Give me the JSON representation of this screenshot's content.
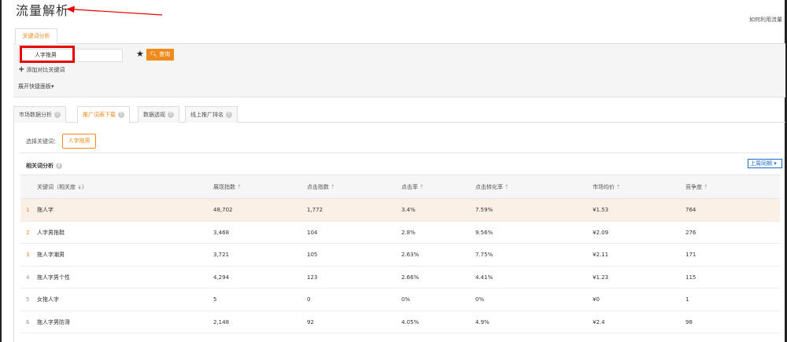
{
  "header": {
    "title": "流量解析",
    "help_link": "如何利用流量"
  },
  "keyword_tab": {
    "label": "关键词分析"
  },
  "search": {
    "value": "人字拖男",
    "query_label": "查询",
    "add_compare": "添加对比关键词",
    "expand_panel": "展开快捷面板▾"
  },
  "nav_tabs": [
    {
      "label": "市场数据分析"
    },
    {
      "label": "推广词表下载"
    },
    {
      "label": "数据透视"
    },
    {
      "label": "线上推广排名"
    }
  ],
  "select_keyword": {
    "label": "选择关键词：",
    "chip": "人字拖男"
  },
  "related": {
    "title": "相关词分析",
    "period": "上周同期 ▾"
  },
  "table": {
    "headers": [
      "关键词（相关度 ⇣）",
      "展现指数",
      "点击指数",
      "点击率",
      "点击转化率",
      "市场均价",
      "竞争度"
    ],
    "rows": [
      {
        "rank": "1",
        "keyword": "拖人字",
        "impressions": "48,702",
        "clicks": "1,772",
        "ctr": "3.4%",
        "cvr": "7.59%",
        "price": "¥1.53",
        "competition": "764"
      },
      {
        "rank": "2",
        "keyword": "人字男拖鞋",
        "impressions": "3,468",
        "clicks": "104",
        "ctr": "2.8%",
        "cvr": "9.56%",
        "price": "¥2.09",
        "competition": "276"
      },
      {
        "rank": "3",
        "keyword": "拖人字潮男",
        "impressions": "3,721",
        "clicks": "105",
        "ctr": "2.63%",
        "cvr": "7.75%",
        "price": "¥2.11",
        "competition": "171"
      },
      {
        "rank": "4",
        "keyword": "拖人字男个性",
        "impressions": "4,294",
        "clicks": "123",
        "ctr": "2.66%",
        "cvr": "4.41%",
        "price": "¥1.23",
        "competition": "115"
      },
      {
        "rank": "5",
        "keyword": "女拖人字",
        "impressions": "5",
        "clicks": "0",
        "ctr": "0%",
        "cvr": "0%",
        "price": "¥0",
        "competition": "1"
      },
      {
        "rank": "6",
        "keyword": "拖人字男防滑",
        "impressions": "2,148",
        "clicks": "92",
        "ctr": "4.05%",
        "cvr": "4.9%",
        "price": "¥2.4",
        "competition": "98"
      }
    ]
  },
  "colors": {
    "accent": "#f08a1c",
    "annotation": "#e60000",
    "link": "#1a6ecc"
  }
}
